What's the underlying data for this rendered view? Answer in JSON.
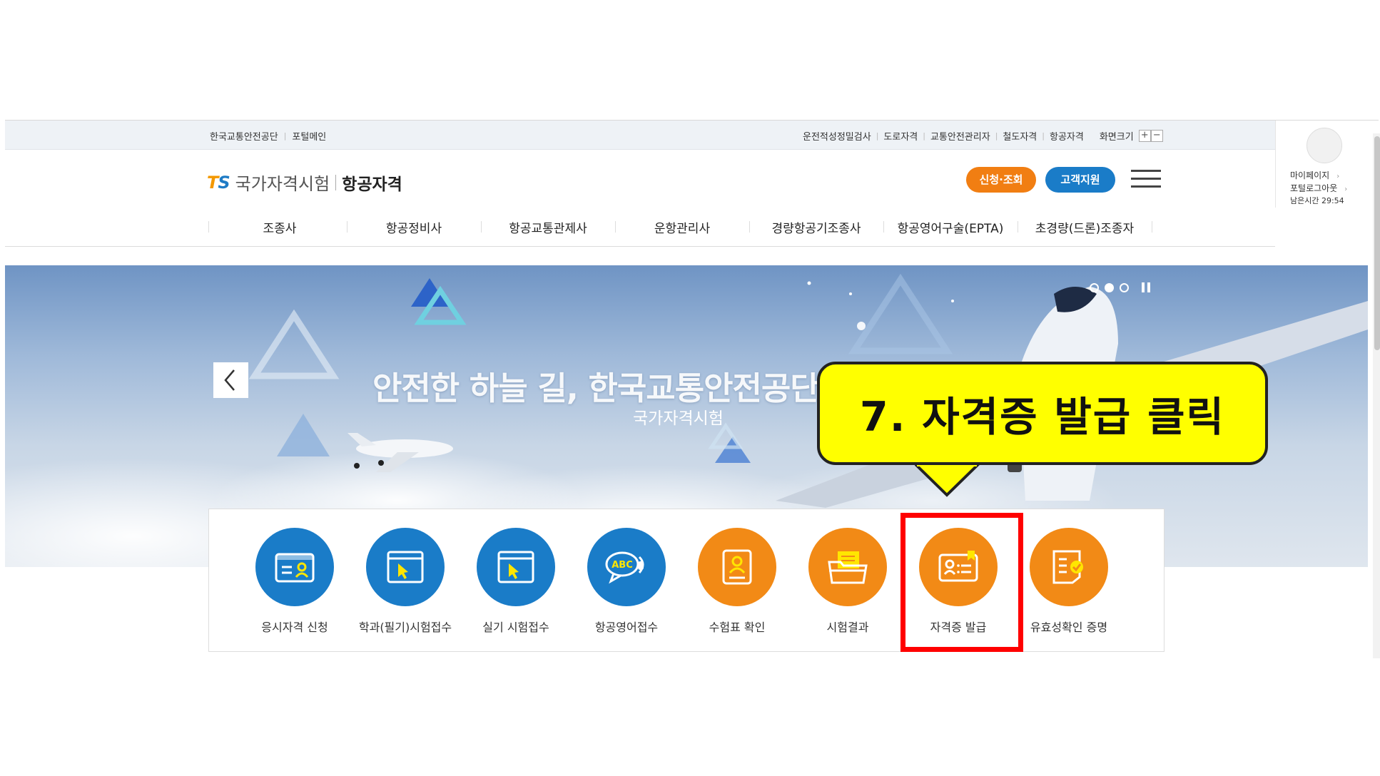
{
  "util_bar": {
    "left_links": [
      "한국교통안전공단",
      "포털메인"
    ],
    "right_links": [
      "운전적성정밀검사",
      "도로자격",
      "교통안전관리자",
      "철도자격",
      "항공자격"
    ],
    "zoom_label": "화면크기",
    "zoom_in": "+",
    "zoom_out": "−"
  },
  "header": {
    "logo_t": "T",
    "logo_s": "S",
    "logo_main": "국가자격시험",
    "logo_sub": "항공자격",
    "apply_button": "신청·조회",
    "support_button": "고객지원",
    "menu_icon": "hamburger-icon"
  },
  "side_panel": {
    "mypage": "마이페이지",
    "logout": "포털로그아웃",
    "remaining_time": "남은시간 29:54"
  },
  "gnb": {
    "items": [
      "조종사",
      "항공정비사",
      "항공교통관제사",
      "운항관리사",
      "경량항공기조종사",
      "항공영어구술(EPTA)",
      "초경량(드론)조종자"
    ]
  },
  "hero": {
    "title": "안전한 하늘 길, 한국교통안전공단이 함께합니다",
    "subtitle": "국가자격시험",
    "slide_count": 3,
    "active_slide": 2
  },
  "quick_menu": {
    "items": [
      {
        "label": "응시자격 신청",
        "icon": "id-card-icon",
        "color": "#1a7cc8"
      },
      {
        "label": "학과(필기)시험접수",
        "icon": "window-cursor-icon",
        "color": "#1a7cc8"
      },
      {
        "label": "실기 시험접수",
        "icon": "window-cursor-icon",
        "color": "#1a7cc8"
      },
      {
        "label": "항공영어접수",
        "icon": "abc-speech-icon",
        "color": "#1a7cc8"
      },
      {
        "label": "수험표 확인",
        "icon": "ticket-person-icon",
        "color": "#f28a16"
      },
      {
        "label": "시험결과",
        "icon": "folder-docs-icon",
        "color": "#f28a16"
      },
      {
        "label": "자격증 발급",
        "icon": "license-card-icon",
        "color": "#f28a16"
      },
      {
        "label": "유효성확인 증명",
        "icon": "document-check-icon",
        "color": "#f28a16"
      }
    ]
  },
  "callout": {
    "text": "7. 자격증 발급 클릭",
    "color": "#ffff00"
  },
  "highlight_color": "#ff0000"
}
